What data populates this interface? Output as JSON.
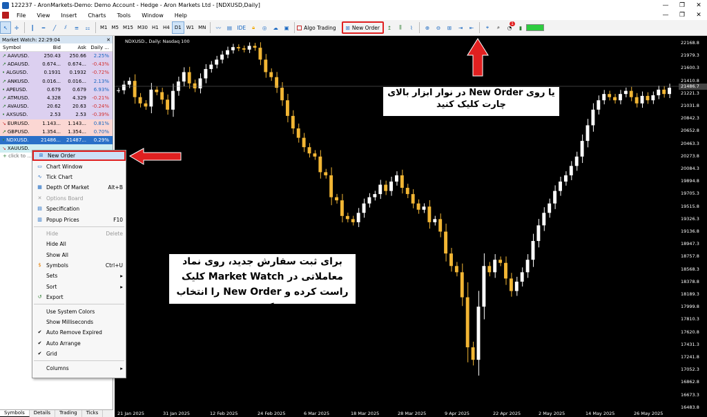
{
  "window": {
    "title": "122237 - AronMarkets-Demo: Demo Account - Hedge - Aron Markets Ltd - [NDXUSD,Daily]"
  },
  "menu": [
    "File",
    "View",
    "Insert",
    "Charts",
    "Tools",
    "Window",
    "Help"
  ],
  "toolbar": {
    "timeframes": [
      "M1",
      "M5",
      "M15",
      "M30",
      "H1",
      "H4",
      "D1",
      "W1",
      "MN"
    ],
    "active_timeframe": "D1",
    "algo_label": "Algo Trading",
    "new_order_label": "New Order",
    "notif_count": "1"
  },
  "market_watch": {
    "header": "Market Watch: 22:29:04",
    "columns": [
      "Symbol",
      "Bid",
      "Ask",
      "Daily ..."
    ],
    "rows": [
      {
        "symbol": "AAVUSD.",
        "bid": "250.43",
        "ask": "250.66",
        "daily": "2.25%",
        "style": "p",
        "dir": "up"
      },
      {
        "symbol": "ADAUSD.",
        "bid": "0.674...",
        "ask": "0.674...",
        "daily": "-0.43%",
        "style": "p",
        "dir": "up"
      },
      {
        "symbol": "ALGUSD.",
        "bid": "0.1931",
        "ask": "0.1932",
        "daily": "-0.72%",
        "style": "p",
        "dir": "dot"
      },
      {
        "symbol": "ANKUSD.",
        "bid": "0.016...",
        "ask": "0.016...",
        "daily": "2.13%",
        "style": "p",
        "dir": "up"
      },
      {
        "symbol": "APEUSD.",
        "bid": "0.679",
        "ask": "0.679",
        "daily": "6.93%",
        "style": "p",
        "dir": "dot"
      },
      {
        "symbol": "ATMUSD.",
        "bid": "4.328",
        "ask": "4.329",
        "daily": "-0.21%",
        "style": "p",
        "dir": "up"
      },
      {
        "symbol": "AVAUSD.",
        "bid": "20.62",
        "ask": "20.63",
        "daily": "-0.24%",
        "style": "p",
        "dir": "up"
      },
      {
        "symbol": "AXSUSD.",
        "bid": "2.53",
        "ask": "2.53",
        "daily": "-0.39%",
        "style": "p",
        "dir": "dot"
      },
      {
        "symbol": "EURUSD.",
        "bid": "1.143...",
        "ask": "1.143...",
        "daily": "0.81%",
        "style": "r",
        "dir": "dn"
      },
      {
        "symbol": "GBPUSD.",
        "bid": "1.354...",
        "ask": "1.354...",
        "daily": "0.70%",
        "style": "r",
        "dir": "up"
      },
      {
        "symbol": "NDXUSD.",
        "bid": "21486...",
        "ask": "21487...",
        "daily": "0.29%",
        "style": "b",
        "dir": "dot"
      },
      {
        "symbol": "XAUUSD.",
        "bid": "",
        "ask": "",
        "daily": "",
        "style": "c",
        "dir": "dn"
      }
    ],
    "add_symbol": "click to ...",
    "tabs": [
      "Symbols",
      "Details",
      "Trading",
      "Ticks"
    ]
  },
  "context_menu": [
    {
      "label": "New Order",
      "shortcut": "",
      "icon": "new-order-icon",
      "state": "hl"
    },
    {
      "label": "Chart Window",
      "shortcut": "",
      "icon": "chart-window-icon",
      "state": ""
    },
    {
      "label": "Tick Chart",
      "shortcut": "",
      "icon": "tick-chart-icon",
      "state": ""
    },
    {
      "label": "Depth Of Market",
      "shortcut": "Alt+B",
      "icon": "depth-of-market-icon",
      "state": ""
    },
    {
      "label": "Options Board",
      "shortcut": "",
      "icon": "options-board-icon",
      "state": "dis"
    },
    {
      "label": "Specification",
      "shortcut": "",
      "icon": "specification-icon",
      "state": ""
    },
    {
      "label": "Popup Prices",
      "shortcut": "F10",
      "icon": "popup-prices-icon",
      "state": ""
    },
    {
      "sep": true
    },
    {
      "label": "Hide",
      "shortcut": "Delete",
      "icon": "",
      "state": "dis"
    },
    {
      "label": "Hide All",
      "shortcut": "",
      "icon": "",
      "state": ""
    },
    {
      "label": "Show All",
      "shortcut": "",
      "icon": "",
      "state": ""
    },
    {
      "label": "Symbols",
      "shortcut": "Ctrl+U",
      "icon": "symbols-icon",
      "state": ""
    },
    {
      "label": "Sets",
      "shortcut": "",
      "icon": "",
      "state": "",
      "submenu": true
    },
    {
      "label": "Sort",
      "shortcut": "",
      "icon": "",
      "state": "",
      "submenu": true
    },
    {
      "label": "Export",
      "shortcut": "",
      "icon": "export-icon",
      "state": ""
    },
    {
      "sep": true
    },
    {
      "label": "Use System Colors",
      "shortcut": "",
      "icon": "",
      "state": ""
    },
    {
      "label": "Show Milliseconds",
      "shortcut": "",
      "icon": "",
      "state": ""
    },
    {
      "label": "Auto Remove Expired",
      "shortcut": "",
      "icon": "check-icon",
      "state": ""
    },
    {
      "label": "Auto Arrange",
      "shortcut": "",
      "icon": "check-icon",
      "state": ""
    },
    {
      "label": "Grid",
      "shortcut": "",
      "icon": "check-icon",
      "state": ""
    },
    {
      "sep": true
    },
    {
      "label": "Columns",
      "shortcut": "",
      "icon": "",
      "state": "",
      "submenu": true
    }
  ],
  "chart": {
    "label": "NDXUSD., Daily:  Nasdaq 100",
    "y_ticks": [
      "22168.8",
      "21979.3",
      "21600.3",
      "21410.8",
      "21221.3",
      "21031.8",
      "20842.3",
      "20652.8",
      "20463.3",
      "20273.8",
      "20084.3",
      "19894.8",
      "19705.3",
      "19515.8",
      "19326.3",
      "19136.8",
      "18947.3",
      "18757.8",
      "18568.3",
      "18378.8",
      "18189.3",
      "17999.8",
      "17810.3",
      "17620.8",
      "17431.3",
      "17241.8",
      "17052.3",
      "16862.8",
      "16673.3",
      "16483.8"
    ],
    "current_price": "21486.7",
    "x_ticks": [
      "21 Jan 2025",
      "31 Jan 2025",
      "12 Feb 2025",
      "24 Feb 2025",
      "6 Mar 2025",
      "18 Mar 2025",
      "28 Mar 2025",
      "9 Apr 2025",
      "22 Apr 2025",
      "2 May 2025",
      "14 May 2025",
      "26 May 2025"
    ]
  },
  "annotations": {
    "top_note": "یا روی New Order در نوار ابزار بالای چارت کلیک کنید",
    "main_note": "برای ثبت سفارش جدید، روی نماد معاملاتی در Market Watch کلیک راست کرده و New Order را انتخاب کنید."
  },
  "colors": {
    "bull": "#ffffff",
    "bear": "#f2b634",
    "arrow": "#e02020"
  }
}
